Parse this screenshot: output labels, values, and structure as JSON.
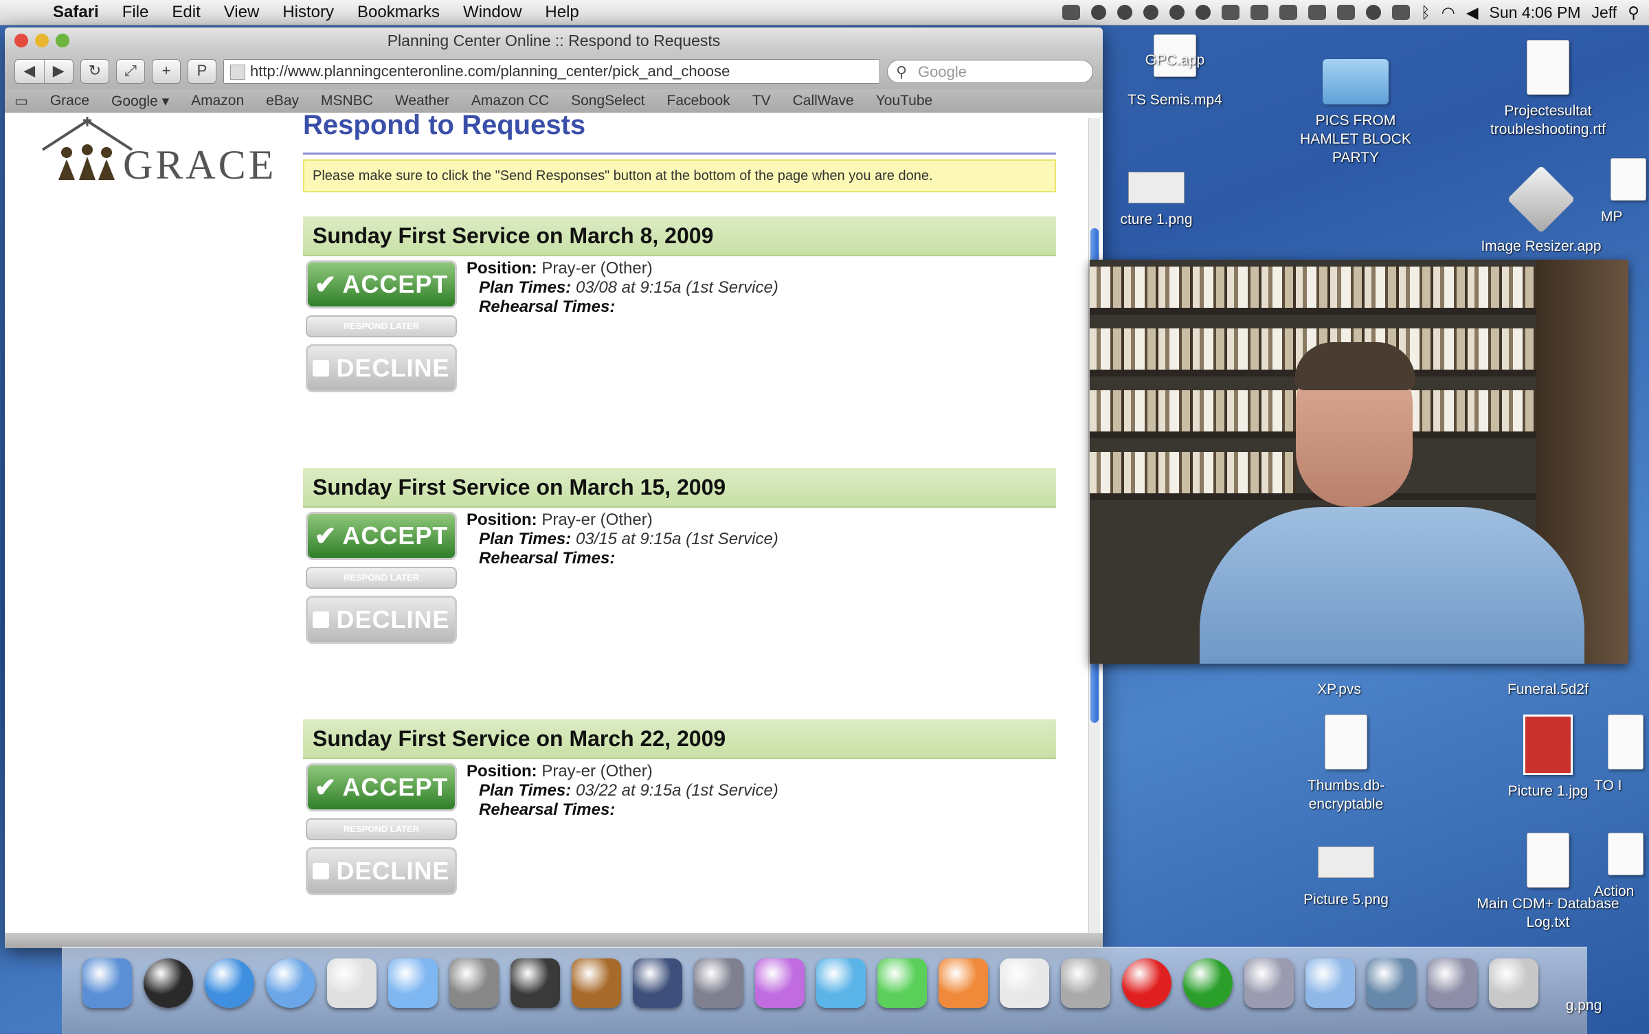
{
  "menubar": {
    "app_name": "Safari",
    "items": [
      "File",
      "Edit",
      "View",
      "History",
      "Bookmarks",
      "Window",
      "Help"
    ],
    "clock": "Sun 4:06 PM",
    "user": "Jeff"
  },
  "window": {
    "title": "Planning Center Online :: Respond to Requests",
    "url": "http://www.planningcenteronline.com/planning_center/pick_and_choose",
    "search_placeholder": "Google",
    "bookmarks": [
      "Grace",
      "Google ▾",
      "Amazon",
      "eBay",
      "MSNBC",
      "Weather",
      "Amazon CC",
      "SongSelect",
      "Facebook",
      "TV",
      "CallWave",
      "YouTube"
    ]
  },
  "page": {
    "logo_text": "GRACE",
    "title": "Respond to Requests",
    "notice": "Please make sure to click the \"Send Responses\" button at the bottom of the page when you are done.",
    "services": [
      {
        "heading": "Sunday First Service on March 8, 2009",
        "position": "Pray-er (Other)",
        "plan_times": "03/08 at 9:15a (1st Service)"
      },
      {
        "heading": "Sunday First Service on March 15, 2009",
        "position": "Pray-er (Other)",
        "plan_times": "03/15 at 9:15a (1st Service)"
      },
      {
        "heading": "Sunday First Service on March 22, 2009",
        "position": "Pray-er (Other)",
        "plan_times": "03/22 at 9:15a (1st Service)"
      }
    ],
    "labels": {
      "accept": "ACCEPT",
      "respond_later": "RESPOND LATER",
      "decline": "DECLINE",
      "position": "Position:",
      "plan_times": "Plan Times:",
      "rehearsal_times": "Rehearsal Times:"
    }
  },
  "desktop": {
    "icons": [
      {
        "label": "GPC.app"
      },
      {
        "label": "TS Semis.mp4"
      },
      {
        "label": "PICS FROM HAMLET BLOCK PARTY"
      },
      {
        "label": "Projectesultat troubleshooting.rtf"
      },
      {
        "label": "cture 1.png"
      },
      {
        "label": "Image Resizer.app"
      },
      {
        "label": "XP.pvs"
      },
      {
        "label": "Funeral.5d2f"
      },
      {
        "label": "Thumbs.db-encryptable"
      },
      {
        "label": "Picture 1.jpg"
      },
      {
        "label": "Picture 5.png"
      },
      {
        "label": "Main CDM+ Database Log.txt"
      },
      {
        "label": "TO I"
      },
      {
        "label": "MP"
      },
      {
        "label": "Action"
      },
      {
        "label": "g.png"
      }
    ]
  },
  "dock": {
    "icons": [
      "finder-icon",
      "dashboard-icon",
      "safari-icon",
      "ichat-icon",
      "mail-icon",
      "itunes-icon",
      "iphoto-icon",
      "imovie-icon",
      "garageband-icon",
      "spaces-icon",
      "time-machine-icon",
      "app-icon",
      "app-icon-2",
      "app-icon-3",
      "app-icon-4",
      "cdm-icon",
      "preview-icon",
      "no-entry-icon",
      "check-icon",
      "photos-icon",
      "folder-icon",
      "network-icon",
      "photo-booth-icon",
      "trash-icon"
    ],
    "colors": [
      "#5a8fd6",
      "#2a2a2a",
      "#3f8fe0",
      "#6aa6e8",
      "#e0e0e0",
      "#7fb7f2",
      "#888888",
      "#3a3a3a",
      "#a86a2a",
      "#3d4f7a",
      "#7f7f8f",
      "#c06ce0",
      "#5ab4e8",
      "#5ad05a",
      "#f08a3a",
      "#e8e8e8",
      "#aaaaaa",
      "#e02020",
      "#2aa02a",
      "#9a9ab0",
      "#8fb8e8",
      "#6688aa",
      "#8e8ea8",
      "#c8c8c8"
    ]
  }
}
